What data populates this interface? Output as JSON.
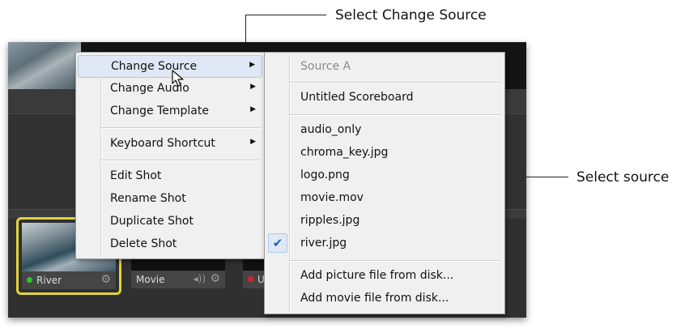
{
  "callouts": {
    "top": "Select Change Source",
    "right": "Select source"
  },
  "context_menu": {
    "items": [
      {
        "label": "Change Source",
        "submenu": true,
        "highlighted": true
      },
      {
        "label": "Change Audio",
        "submenu": true
      },
      {
        "label": "Change Template",
        "submenu": true
      },
      {
        "label": "Keyboard Shortcut",
        "submenu": true
      },
      {
        "label": "Edit Shot"
      },
      {
        "label": "Rename Shot"
      },
      {
        "label": "Duplicate Shot"
      },
      {
        "label": "Delete Shot"
      }
    ]
  },
  "source_menu": {
    "header": "Source A",
    "items": [
      "Untitled Scoreboard",
      "audio_only",
      "chroma_key.jpg",
      "logo.png",
      "movie.mov",
      "ripples.jpg",
      "river.jpg"
    ],
    "checked": "river.jpg",
    "actions": [
      "Add picture file from disk...",
      "Add movie file from disk..."
    ]
  },
  "shots": [
    {
      "label": "River",
      "status_color": "#2fc42f",
      "selected": true
    },
    {
      "label": "Movie",
      "status_color": "",
      "selected": false
    },
    {
      "label": "U",
      "status_color": "#e02020",
      "selected": false
    }
  ],
  "colors": {
    "selection_border": "#e1d33b",
    "menu_highlight": "#dfe8f4",
    "check": "#2060b0"
  }
}
